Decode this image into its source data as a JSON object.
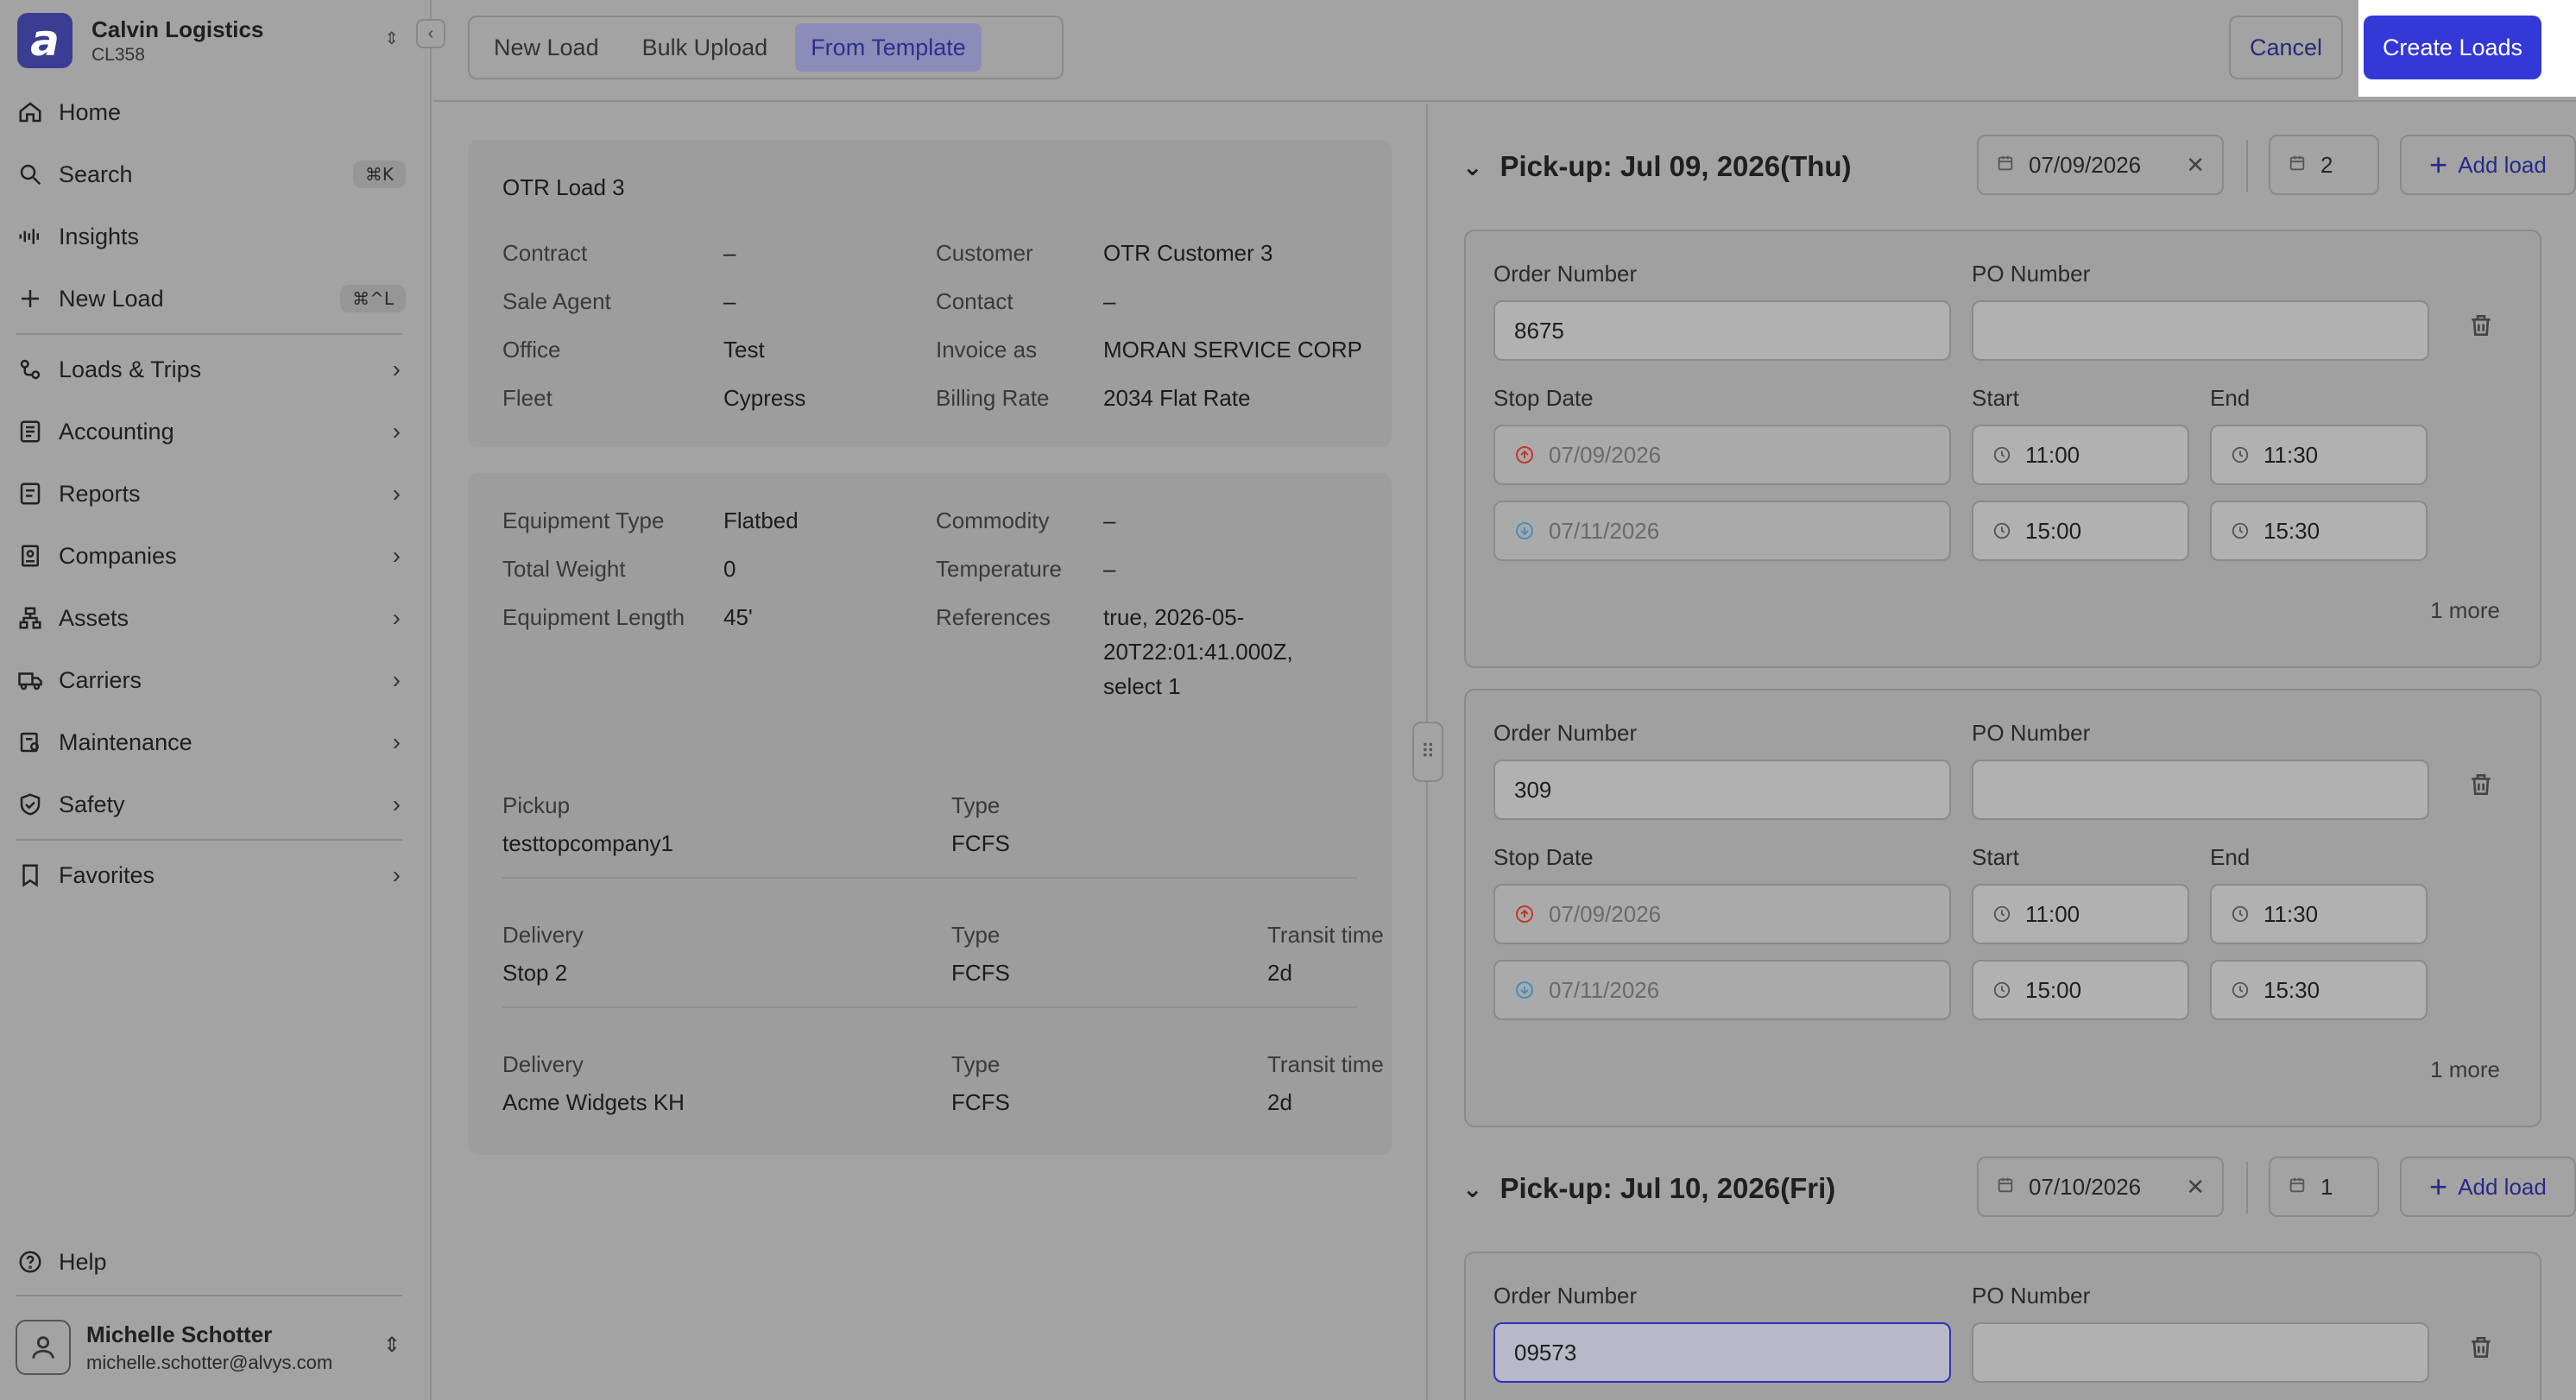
{
  "sidebar": {
    "brand": {
      "name": "Calvin Logistics",
      "code": "CL358"
    },
    "items": [
      {
        "label": "Home"
      },
      {
        "label": "Search",
        "shortcut": "⌘K"
      },
      {
        "label": "Insights"
      },
      {
        "label": "New Load",
        "shortcut": "⌘^L"
      },
      {
        "label": "Loads & Trips"
      },
      {
        "label": "Accounting"
      },
      {
        "label": "Reports"
      },
      {
        "label": "Companies"
      },
      {
        "label": "Assets"
      },
      {
        "label": "Carriers"
      },
      {
        "label": "Maintenance"
      },
      {
        "label": "Safety"
      },
      {
        "label": "Favorites"
      }
    ],
    "help": "Help",
    "user": {
      "name": "Michelle Schotter",
      "email": "michelle.schotter@alvys.com"
    }
  },
  "topbar": {
    "tabs": [
      "New Load",
      "Bulk Upload",
      "From Template"
    ],
    "active_tab": "From Template",
    "cancel": "Cancel",
    "create": "Create Loads"
  },
  "template": {
    "title": "OTR Load 3",
    "info": {
      "contract_label": "Contract",
      "contract": "–",
      "sale_agent_label": "Sale Agent",
      "sale_agent": "–",
      "office_label": "Office",
      "office": "Test",
      "fleet_label": "Fleet",
      "fleet": "Cypress",
      "customer_label": "Customer",
      "customer": "OTR Customer 3",
      "contact_label": "Contact",
      "contact": "–",
      "invoice_label": "Invoice as",
      "invoice": "MORAN SERVICE CORP",
      "billing_label": "Billing Rate",
      "billing": "2034 Flat Rate"
    },
    "equipment": {
      "type_label": "Equipment Type",
      "type": "Flatbed",
      "weight_label": "Total Weight",
      "weight": "0",
      "length_label": "Equipment Length",
      "length": "45'",
      "commodity_label": "Commodity",
      "commodity": "–",
      "temperature_label": "Temperature",
      "temperature": "–",
      "references_label": "References",
      "references_l1": "true, 2026-05-",
      "references_l2": "20T22:01:41.000Z,",
      "references_l3": "select 1"
    },
    "stops": [
      {
        "kind": "Pickup",
        "name": "testtopcompany1",
        "type_label": "Type",
        "type": "FCFS",
        "transit_label": "",
        "transit": ""
      },
      {
        "kind": "Delivery",
        "name": "Stop 2",
        "type_label": "Type",
        "type": "FCFS",
        "transit_label": "Transit time",
        "transit": "2d"
      },
      {
        "kind": "Delivery",
        "name": "Acme Widgets KH",
        "type_label": "Type",
        "type": "FCFS",
        "transit_label": "Transit time",
        "transit": "2d"
      }
    ]
  },
  "pickups": [
    {
      "title": "Pick-up: Jul 09, 2026(Thu)",
      "date": "07/09/2026",
      "count": "2",
      "add": "Add load",
      "orders": [
        {
          "order_label": "Order Number",
          "order": "8675",
          "po_label": "PO Number",
          "po": "",
          "stop_date_label": "Stop Date",
          "start_label": "Start",
          "end_label": "End",
          "rows": [
            {
              "date": "07/09/2026",
              "start": "11:00",
              "end": "11:30"
            },
            {
              "date": "07/11/2026",
              "start": "15:00",
              "end": "15:30"
            }
          ],
          "more": "1 more"
        },
        {
          "order_label": "Order Number",
          "order": "309",
          "po_label": "PO Number",
          "po": "",
          "stop_date_label": "Stop Date",
          "start_label": "Start",
          "end_label": "End",
          "rows": [
            {
              "date": "07/09/2026",
              "start": "11:00",
              "end": "11:30"
            },
            {
              "date": "07/11/2026",
              "start": "15:00",
              "end": "15:30"
            }
          ],
          "more": "1 more"
        }
      ]
    },
    {
      "title": "Pick-up: Jul 10, 2026(Fri)",
      "date": "07/10/2026",
      "count": "1",
      "add": "Add load",
      "orders": [
        {
          "order_label": "Order Number",
          "order": "09573",
          "po_label": "PO Number",
          "po": ""
        }
      ]
    }
  ],
  "colors": {
    "accent": "#3438d6",
    "active_tab": "#2c2f8c",
    "overlay": "#a3a3a3"
  }
}
